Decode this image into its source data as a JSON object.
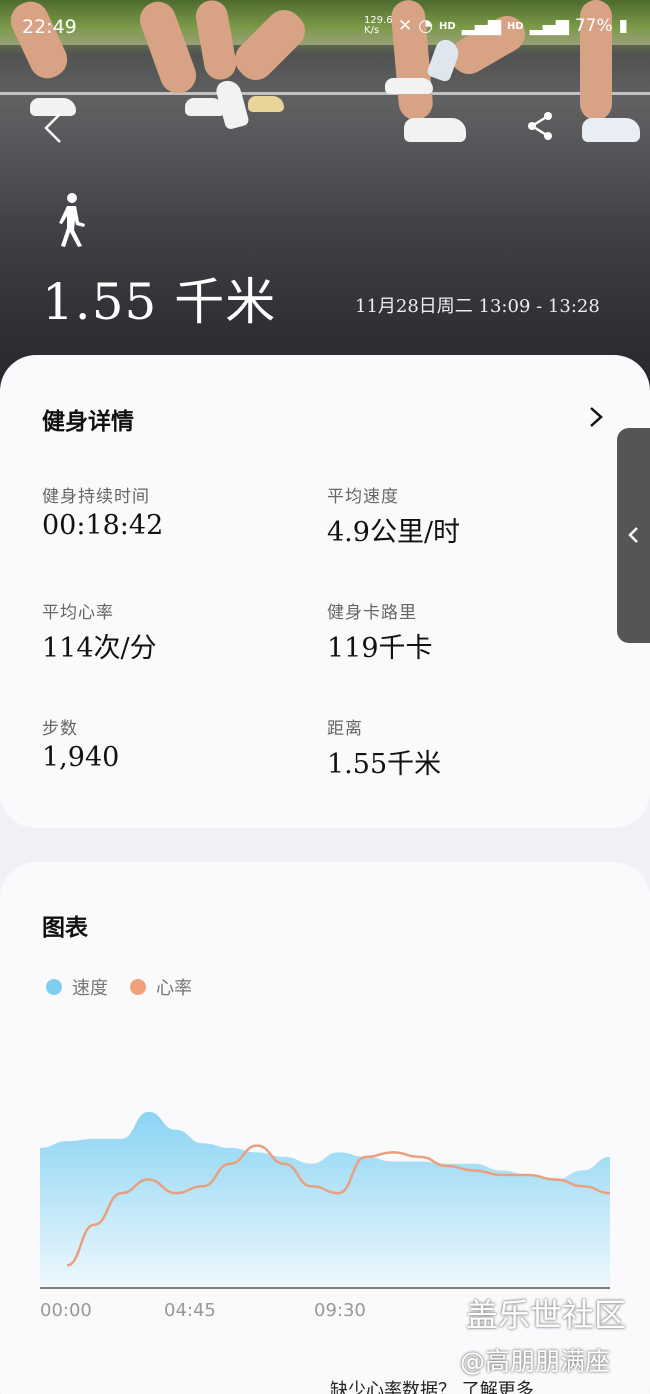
{
  "status_bar": {
    "time": "22:49",
    "net_speed": "129.6 K/s",
    "battery": "77%"
  },
  "header": {
    "activity_icon": "walking-person-icon",
    "distance": "1.55 千米",
    "date_range": "11月28日周二 13:09 - 13:28"
  },
  "details": {
    "title": "健身详情",
    "metrics": [
      {
        "label": "健身持续时间",
        "value": "00:18:42"
      },
      {
        "label": "平均速度",
        "value": "4.9公里/时"
      },
      {
        "label": "平均心率",
        "value": "114次/分"
      },
      {
        "label": "健身卡路里",
        "value": "119千卡"
      },
      {
        "label": "步数",
        "value": "1,940"
      },
      {
        "label": "距离",
        "value": "1.55千米"
      }
    ]
  },
  "chart_section": {
    "title": "图表",
    "legend": [
      {
        "name": "速度",
        "color": "#7fcdf0"
      },
      {
        "name": "心率",
        "color": "#f0a07a"
      }
    ],
    "footer_link": "缺少心率数据？ 了解更多"
  },
  "chart_data": {
    "type": "area",
    "x_ticks": [
      "00:00",
      "04:45",
      "09:30"
    ],
    "series": [
      {
        "name": "速度",
        "values": [
          0.62,
          0.65,
          0.66,
          0.66,
          0.78,
          0.7,
          0.64,
          0.62,
          0.6,
          0.58,
          0.55,
          0.6,
          0.58,
          0.56,
          0.56,
          0.55,
          0.55,
          0.52,
          0.5,
          0.48,
          0.52,
          0.58
        ]
      },
      {
        "name": "心率",
        "values": [
          null,
          0.1,
          0.28,
          0.42,
          0.48,
          0.42,
          0.45,
          0.55,
          0.63,
          0.55,
          0.45,
          0.42,
          0.58,
          0.6,
          0.58,
          0.54,
          0.52,
          0.5,
          0.5,
          0.48,
          0.45,
          0.42
        ]
      }
    ]
  },
  "watermark": {
    "line1": "盖乐世社区",
    "line2": "@高朋朋满座"
  }
}
